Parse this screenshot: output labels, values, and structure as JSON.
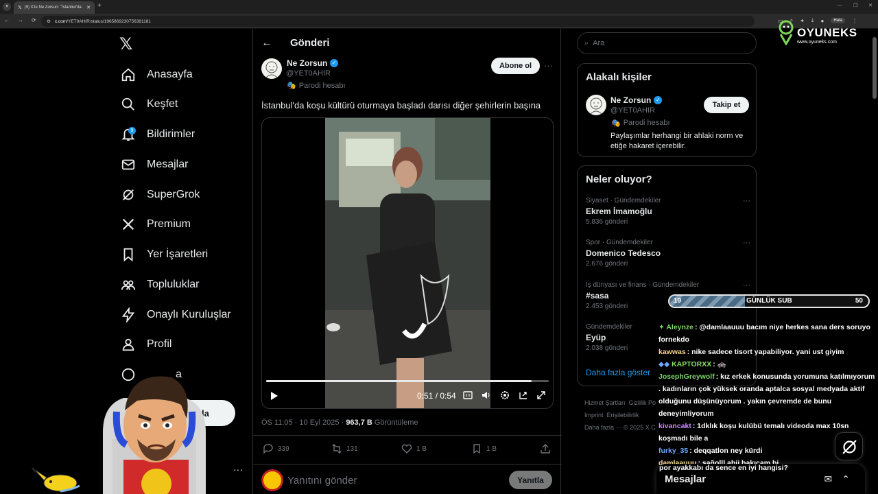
{
  "browser": {
    "tab_title": "(9) X'te Ne Zorsun: \"İstanbul'da",
    "url_host": "x.com",
    "url_path": "/YET0AHIR/status/1965869230756381181",
    "profile_label": "Hata"
  },
  "nav": {
    "items": [
      {
        "label": "Anasayfa",
        "icon": "home-icon"
      },
      {
        "label": "Keşfet",
        "icon": "search-icon"
      },
      {
        "label": "Bildirimler",
        "icon": "bell-icon",
        "badge": "9"
      },
      {
        "label": "Mesajlar",
        "icon": "envelope-icon"
      },
      {
        "label": "SuperGrok",
        "icon": "grok-icon"
      },
      {
        "label": "Premium",
        "icon": "x-icon"
      },
      {
        "label": "Yer İşaretleri",
        "icon": "bookmark-icon"
      },
      {
        "label": "Topluluklar",
        "icon": "communities-icon"
      },
      {
        "label": "Onaylı Kuruluşlar",
        "icon": "lightning-icon"
      },
      {
        "label": "Profil",
        "icon": "person-icon"
      },
      {
        "label": "a",
        "icon": "more-circle-icon"
      }
    ],
    "post_button": "unla",
    "account_name": "li"
  },
  "post": {
    "header_title": "Gönderi",
    "author_name": "Ne Zorsun",
    "author_handle": "@YET0AHIR",
    "parody_label": "Parodi hesabı",
    "subscribe_label": "Abone ol",
    "text": "İstanbul'da koşu kültürü oturmaya başladı darısı diğer şehirlerin başına",
    "video": {
      "time": "0:51 / 0:54",
      "progress": 0.94
    },
    "meta_time": "ÖS 11:05 · 10 Eyl 2025 · ",
    "meta_views": "963,7 B",
    "meta_views_label": " Görüntüleme",
    "stats": {
      "replies": "339",
      "reposts": "131",
      "likes": "1 B",
      "bookmarks": "1 B"
    },
    "reply_placeholder": "Yanıtını gönder",
    "reply_button": "Yanıtla"
  },
  "sidebar": {
    "search_placeholder": "Ara",
    "related_title": "Alakalı kişiler",
    "related": {
      "name": "Ne Zorsun",
      "handle": "@YET0AHIR",
      "parody": "Parodi hesabı",
      "bio": "Paylaşımlar herhangi bir ahlaki norm ve etiğe hakaret içerebilir.",
      "follow": "Takip et"
    },
    "trends_title": "Neler oluyor?",
    "trends": [
      {
        "context": "Siyaset · Gündemdekiler",
        "name": "Ekrem İmamoğlu",
        "count": "5.836 gönderi"
      },
      {
        "context": "Spor · Gündemdekiler",
        "name": "Domenico Tedesco",
        "count": "2.676 gönderi"
      },
      {
        "context": "İş dünyası ve finans · Gündemdekiler",
        "name": "#sasa",
        "count": "2.453 gönderi"
      },
      {
        "context": "Gündemdekiler",
        "name": "Eyüp",
        "count": "2.038 gönderi"
      }
    ],
    "show_more": "Daha fazla göster",
    "footer": [
      "Hizmet Şartları",
      "Gizlilik Po",
      "Imprint",
      "Erişilebilirlik",
      "Daha fazla ···",
      "© 2025 X C"
    ]
  },
  "overlay": {
    "brand_name": "OYUNEKS",
    "brand_url": "www.oyuneks.com",
    "sub_goal": {
      "current": "19",
      "label": "GÜNLÜK SUB",
      "target": "50",
      "progress": 0.38
    },
    "chat": [
      {
        "user": "Aleynze",
        "color": "#7fd36a",
        "text": ": @damlaauuu bacım niye herkes sana ders soruyo fornekdo"
      },
      {
        "user": "kawwas",
        "color": "#f4d38a",
        "text": ": nike sadece tisort yapabiliyor. yani ust giyim"
      },
      {
        "user": "KAPTORXX",
        "color": "#8be06a",
        "text": ": 🚓"
      },
      {
        "user": "JosephGreywolf",
        "color": "#7fd36a",
        "text": ": kız erkek konusunda yorumuna katılmıyorum . kadınların çok yüksek oranda aptalca sosyal medyada aktif olduğunu düşünüyorum . yakın çevremde de bunu deneyimliyorum"
      },
      {
        "user": "kivancakt",
        "color": "#c58cff",
        "text": ": 1dklık koşu kulübü temalı videoda max 10sn koşmadı bile a"
      },
      {
        "user": "furky_35",
        "color": "#6fa8ff",
        "text": ": deqqatlon ney kürdi"
      },
      {
        "user": "damlaauuu",
        "color": "#f4d38a",
        "text": ": sağolll abii bakıcam bi"
      },
      {
        "user": "",
        "color": "#ffffff",
        "text": "por ayakkabı da sence en iyi hangisi?"
      }
    ],
    "messages_title": "Mesajlar"
  }
}
